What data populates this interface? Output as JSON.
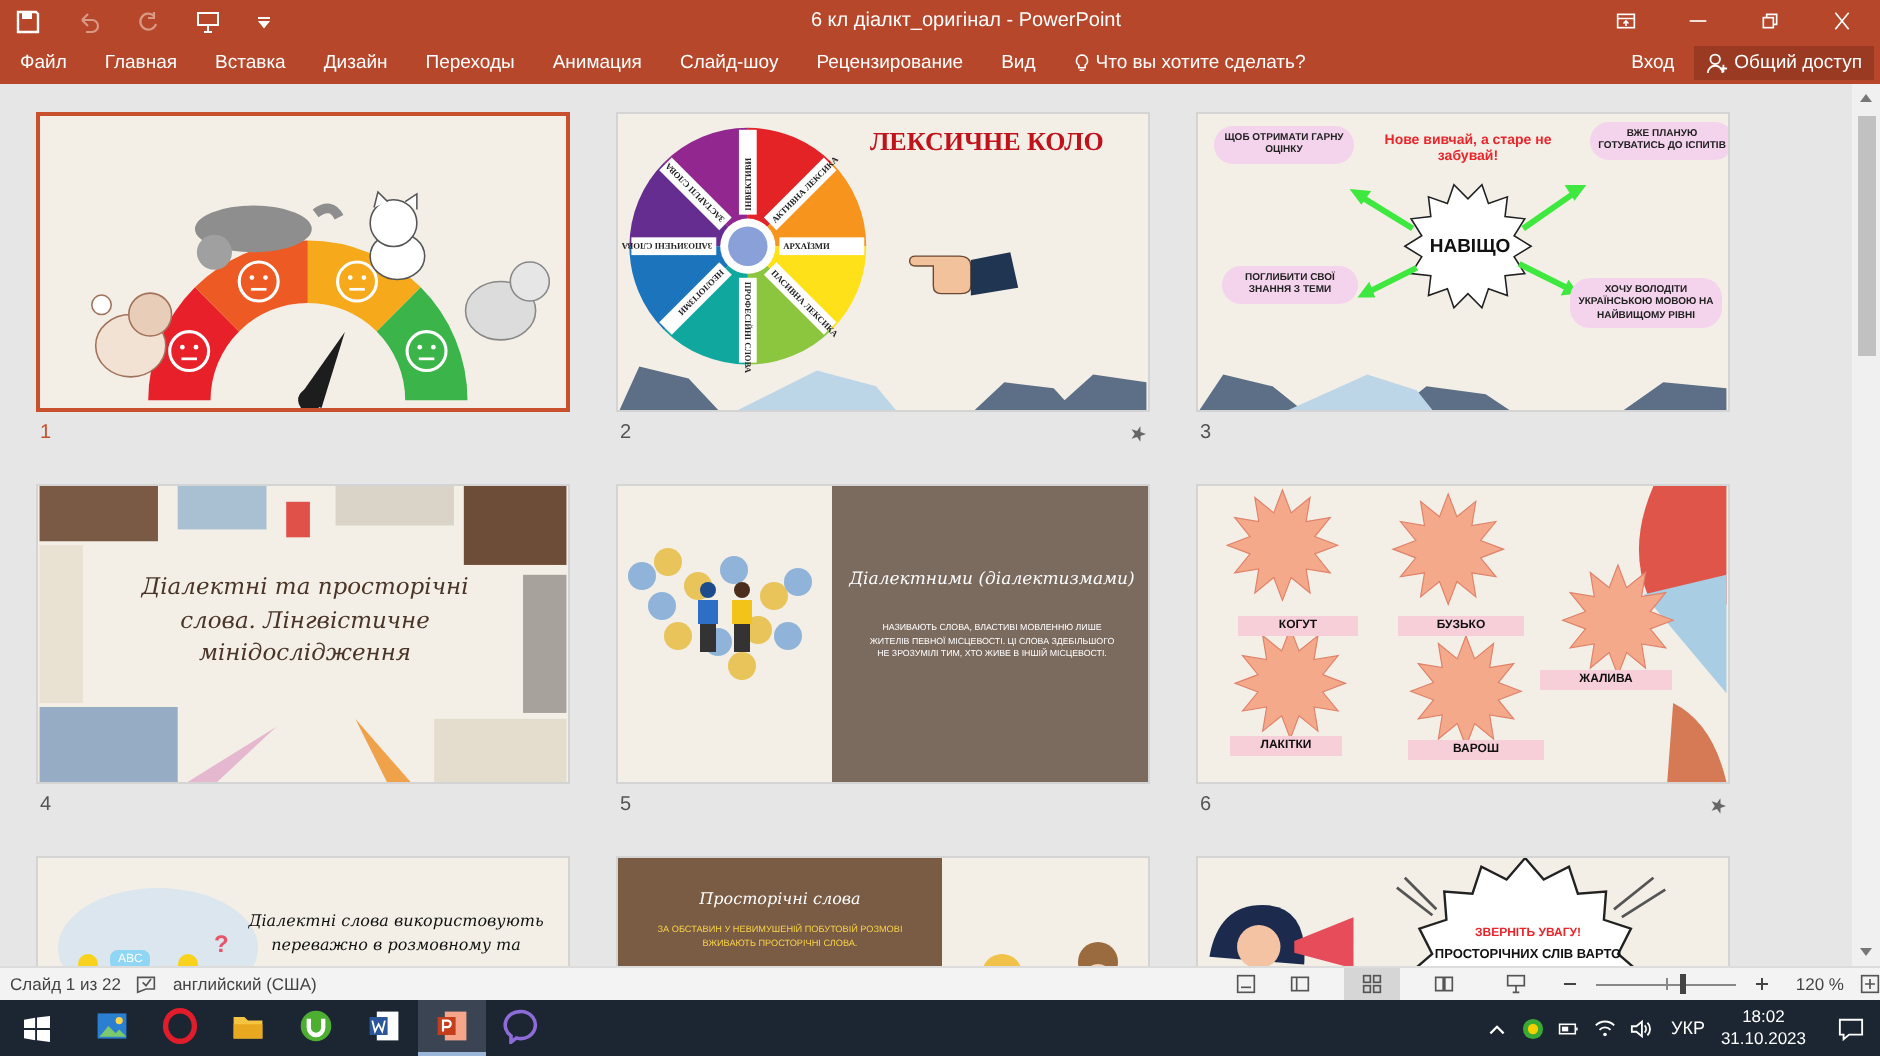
{
  "window": {
    "title": "6 кл діалкт_оригінал - PowerPoint"
  },
  "quick_access": [
    {
      "kind": "save",
      "disabled": false
    },
    {
      "kind": "undo",
      "disabled": true
    },
    {
      "kind": "redo",
      "disabled": true
    },
    {
      "kind": "present",
      "disabled": false
    },
    {
      "kind": "customize",
      "disabled": false
    }
  ],
  "ribbon_tabs": [
    "Файл",
    "Главная",
    "Вставка",
    "Дизайн",
    "Переходы",
    "Анимация",
    "Слайд-шоу",
    "Рецензирование",
    "Вид"
  ],
  "tell_me": {
    "placeholder": "Что вы хотите сделать?"
  },
  "sign_in": "Вход",
  "share": "Общий доступ",
  "slides": [
    {
      "number": "1",
      "selected": true,
      "animated": false,
      "kind": "gauge"
    },
    {
      "number": "2",
      "selected": false,
      "animated": true,
      "kind": "wheel",
      "title": "ЛЕКСИЧНЕ КОЛО",
      "labels": [
        "ІНВЕКТИВИ",
        "АКТИВНА ЛЕКСИКА",
        "АРХАЇЗМИ",
        "ПАСИВНА ЛЕКСИКА",
        "ПРОФЕСІЙНІ СЛОВА",
        "НЕОЛОГІЗМИ",
        "ЗАПОЗИЧЕНІ СЛОВА",
        "ЗАСТАРІЛІ СЛОВА"
      ]
    },
    {
      "number": "3",
      "selected": false,
      "animated": false,
      "kind": "mindmap",
      "heading": "Нове вивчай, а старе не забувай!",
      "center": "НАВІЩО",
      "notes": [
        "ЩОБ ОТРИМАТИ ГАРНУ ОЦІНКУ",
        "ВЖЕ ПЛАНУЮ ГОТУВАТИСЬ ДО ІСПИТІВ",
        "ПОГЛИБИТИ СВОЇ ЗНАННЯ З ТЕМИ",
        "ХОЧУ ВОЛОДІТИ УКРАЇНСЬКОЮ МОВОЮ НА НАЙВИЩОМУ РІВНІ"
      ]
    },
    {
      "number": "4",
      "selected": false,
      "animated": false,
      "kind": "title",
      "title": "Діалектні та просторічні слова. Лінгвістичне мінідослідження"
    },
    {
      "number": "5",
      "selected": false,
      "animated": false,
      "kind": "split",
      "title": "Діалектними (діалектизмами)",
      "body": "НАЗИВАЮТЬ СЛОВА, ВЛАСТИВІ МОВЛЕННЮ ЛИШЕ ЖИТЕЛІВ ПЕВНОЇ МІСЦЕВОСТІ. ЦІ СЛОВА ЗДЕБІЛЬШОГО НЕ ЗРОЗУМІЛІ ТИМ, ХТО ЖИВЕ В ІНШІЙ МІСЦЕВОСТІ."
    },
    {
      "number": "6",
      "selected": false,
      "animated": true,
      "kind": "stickers",
      "words": [
        "КОГУТ",
        "БУЗЬКО",
        "ЖАЛИВА",
        "ЛАКІТКИ",
        "ВАРОШ"
      ]
    },
    {
      "selected": false,
      "kind": "usage",
      "badge": "ABC",
      "mark": "?",
      "text": "Діалектні слова використовують переважно в розмовному та"
    },
    {
      "selected": false,
      "kind": "colloquial",
      "title": "Просторічні слова",
      "body": "ЗА ОБСТАВИН У НЕВИМУШЕНІЙ ПОБУТОВІЙ РОЗМОВІ ВЖИВАЮТЬ ПРОСТОРІЧНІ СЛОВА."
    },
    {
      "selected": false,
      "kind": "callout",
      "heading": "ЗВЕРНІТЬ УВАГУ!",
      "text": "ПРОСТОРІЧНИХ СЛІВ ВАРТО"
    }
  ],
  "status_bar": {
    "slide_info": "Слайд 1 из 22",
    "language": "английский (США)",
    "views": [
      {
        "kind": "normal",
        "selected": false
      },
      {
        "kind": "sorter",
        "selected": true
      },
      {
        "kind": "reading",
        "selected": false
      },
      {
        "kind": "slideshow",
        "selected": false
      }
    ],
    "zoom": {
      "level": 0.62,
      "reading": "120 %"
    }
  },
  "taskbar": {
    "apps": [
      {
        "kind": "photos",
        "selected": false
      },
      {
        "kind": "opera",
        "selected": false
      },
      {
        "kind": "explorer",
        "selected": false
      },
      {
        "kind": "torrent",
        "selected": false
      },
      {
        "kind": "word",
        "selected": false
      },
      {
        "kind": "powerpoint",
        "selected": true
      },
      {
        "kind": "viber",
        "selected": false
      }
    ],
    "language": "УКР",
    "time": "18:02",
    "date": "31.10.2023"
  }
}
